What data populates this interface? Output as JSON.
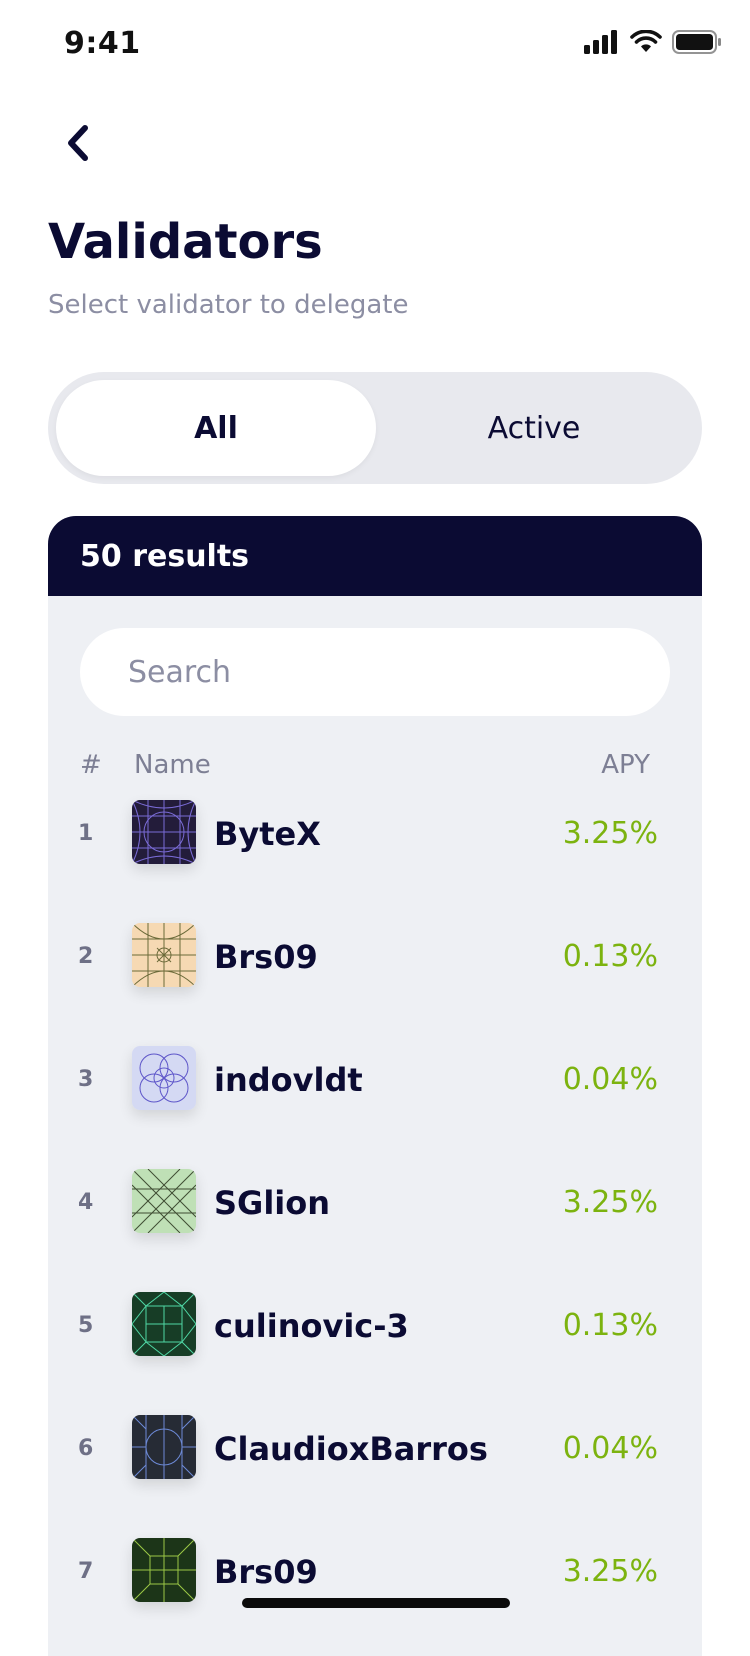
{
  "status": {
    "time": "9:41"
  },
  "header": {
    "title": "Validators",
    "subtitle": "Select validator to delegate"
  },
  "tabs": [
    {
      "label": "All",
      "active": true
    },
    {
      "label": "Active",
      "active": false
    }
  ],
  "results": {
    "count_label": "50 results"
  },
  "search": {
    "placeholder": "Search",
    "value": ""
  },
  "columns": {
    "rank": "#",
    "name": "Name",
    "apy": "APY"
  },
  "validators": [
    {
      "rank": "1",
      "name": "ByteX",
      "apy": "3.25%",
      "avatar_bg": "#231c3a",
      "avatar_line": "#7a6bd6"
    },
    {
      "rank": "2",
      "name": "Brs09",
      "apy": "0.13%",
      "avatar_bg": "#f6d9b3",
      "avatar_line": "#6b6a39"
    },
    {
      "rank": "3",
      "name": "indovldt",
      "apy": "0.04%",
      "avatar_bg": "#d4d9f3",
      "avatar_line": "#5e56c9"
    },
    {
      "rank": "4",
      "name": "SGlion",
      "apy": "3.25%",
      "avatar_bg": "#bfe0b6",
      "avatar_line": "#3f4d33"
    },
    {
      "rank": "5",
      "name": "culinovic-3",
      "apy": "0.13%",
      "avatar_bg": "#173d26",
      "avatar_line": "#4fd6a4"
    },
    {
      "rank": "6",
      "name": "ClaudioxBarros",
      "apy": "0.04%",
      "avatar_bg": "#262b35",
      "avatar_line": "#6d8ad7"
    },
    {
      "rank": "7",
      "name": "Brs09",
      "apy": "3.25%",
      "avatar_bg": "#1c3518",
      "avatar_line": "#9bc846"
    }
  ],
  "colors": {
    "accent_dark": "#0b0b33",
    "apy_green": "#7cb30f",
    "muted": "#8c8ea3"
  },
  "icons": {
    "back": "chevron-left-icon",
    "signal": "cellular-signal-icon",
    "wifi": "wifi-icon",
    "battery": "battery-icon"
  }
}
